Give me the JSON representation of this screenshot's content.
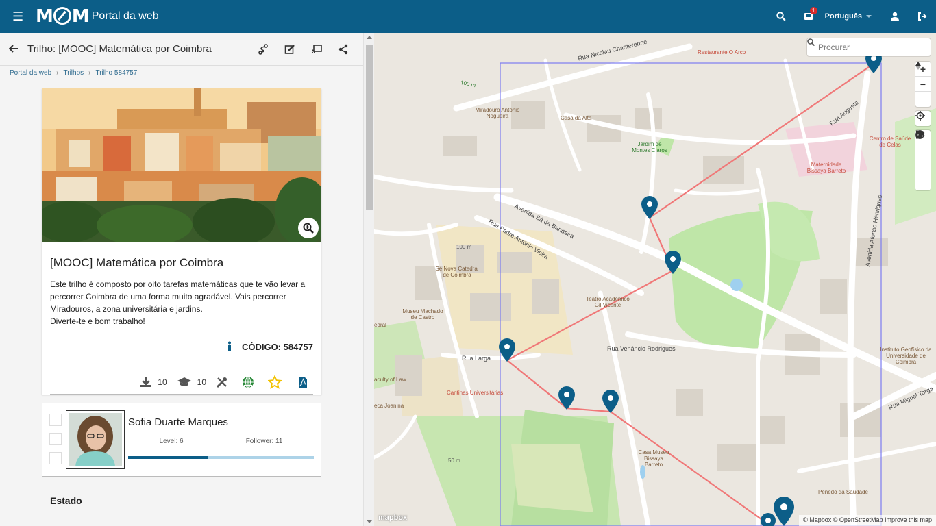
{
  "header": {
    "app_title": "Portal da web",
    "logo_text": "MCM",
    "notifications_count": "1",
    "language": "Português"
  },
  "panel": {
    "title": "Trilho: [MOOC] Matemática por Coimbra",
    "breadcrumb": [
      "Portal da web",
      "Trilhos",
      "Trilho 584757"
    ]
  },
  "trail": {
    "name": "[MOOC] Matemática por Coimbra",
    "description_lines": [
      "Este trilho é composto por oito tarefas matemáticas que te vão levar a",
      "percorrer Coimbra de uma forma muito agradável. Vais percorrer",
      "Miradouros, a zona universitária e jardins.",
      "Diverte-te e bom trabalho!"
    ],
    "code_label": "CÓDIGO: 584757",
    "downloads": "10",
    "students": "10"
  },
  "author": {
    "name": "Sofia Duarte Marques",
    "level_label": "Level: 6",
    "follower_label": "Follower: 11",
    "progress": 0.43
  },
  "section": {
    "estado": "Estado"
  },
  "map": {
    "search_placeholder": "Procurar",
    "attribution": "© Mapbox © OpenStreetMap Improve this map",
    "mapbox_logo": "mapbox",
    "labels": {
      "rua_nicolau": "Rua Nicolau Chanterenne",
      "restaurante": "Restaurante O Arco",
      "miradouro": "Miradouro António Nogueira",
      "casa_alta": "Casa da Alta",
      "jardim": "Jardim de Montes Claros",
      "rua_augusta": "Rua Augusta",
      "centro_saude": "Centro de Saúde de Celas",
      "maternidade": "Maternidade Bissaya Barreto",
      "avenida_sa": "Avenida Sá da Bandeira",
      "rua_padre": "Rua Padre António Vieira",
      "avenida_afonso": "Avenida Afonso Henriques",
      "se_nova": "Sé Nova Catedral de Coimbra",
      "teatro": "Teatro Académico Gil Vicente",
      "museu": "Museu Machado de Castro",
      "rua_larga": "Rua Larga",
      "rua_venancio": "Rua Venâncio Rodrigues",
      "instituto": "Instituto Geofísico da Universidade de Coimbra",
      "rua_miguel": "Rua Miguel Torga",
      "faculty_law": "aculty of Law",
      "cantinas": "Cantinas Universitárias",
      "joanina": "eca Joanina",
      "casa_museu": "Casa Museu Bissaya Barreto",
      "penedo": "Penedo da Saudade",
      "edral": "edral",
      "contour_100a": "100 m",
      "contour_100b": "100 m",
      "contour_50": "50 m"
    }
  },
  "colors": {
    "primary": "#0c5e88",
    "route": "#f07878",
    "bbox": "#7b7bf0",
    "park": "#b9e3a2",
    "marker": "#0c5e88",
    "star": "#f2c200",
    "globe": "#2a8a3a"
  }
}
